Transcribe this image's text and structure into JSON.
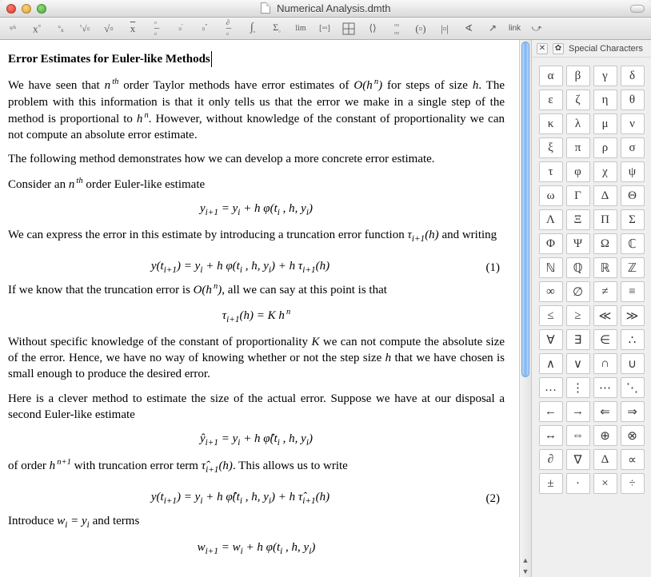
{
  "window": {
    "title": "Numerical Analysis.dmth"
  },
  "toolbar": {
    "link_label": "link"
  },
  "palette": {
    "title": "Special Characters",
    "symbols": [
      "α",
      "β",
      "γ",
      "δ",
      "ε",
      "ζ",
      "η",
      "θ",
      "κ",
      "λ",
      "μ",
      "ν",
      "ξ",
      "π",
      "ρ",
      "σ",
      "τ",
      "φ",
      "χ",
      "ψ",
      "ω",
      "Γ",
      "Δ",
      "Θ",
      "Λ",
      "Ξ",
      "Π",
      "Σ",
      "Φ",
      "Ψ",
      "Ω",
      "ℂ",
      "ℕ",
      "ℚ",
      "ℝ",
      "ℤ",
      "∞",
      "∅",
      "≠",
      "≡",
      "≤",
      "≥",
      "≪",
      "≫",
      "∀",
      "∃",
      "∈",
      "∴",
      "∧",
      "∨",
      "∩",
      "∪",
      "…",
      "⋮",
      "⋯",
      "⋱",
      "←",
      "→",
      "⇐",
      "⇒",
      "↔",
      "⇔",
      "⊕",
      "⊗",
      "∂",
      "∇",
      "Δ",
      "∝",
      "±",
      "·",
      "×",
      "÷"
    ]
  },
  "doc": {
    "heading": "Error Estimates for Euler-like Methods",
    "p1a": "We have seen that ",
    "p1b": " order Taylor methods have error estimates of ",
    "p1c": " for steps of size ",
    "p1d": ". The problem with this information is that it only tells us that the error we make in a single step of the method is proportional to ",
    "p1e": ". However, without knowledge of the constant of proportionality we can not compute an absolute error estimate.",
    "p2": "The following method demonstrates how we can develop a more concrete error estimate.",
    "p3a": "Consider an ",
    "p3b": " order Euler-like estimate",
    "eq1": "y<sub>i+1</sub> = y<sub>i</sub> + h φ(t<sub>i</sub> , h, y<sub>i</sub>)",
    "p4a": "We can express the error in this estimate by introducing a truncation error function ",
    "p4b": " and writing",
    "eq2": "y(t<sub>i+1</sub>) = y<sub>i</sub> + h φ(t<sub>i</sub> , h, y<sub>i</sub>) + h τ<sub>i+1</sub>(h)",
    "eq2num": "(1)",
    "p5a": "If we know that the truncation error is ",
    "p5b": ", all we can say at this point is that",
    "eq3": "τ<sub>i+1</sub>(h) = K h<sup>&thinsp;n</sup>",
    "p6a": "Without specific knowledge of the constant of proportionality ",
    "p6b": " we can not compute the absolute size of the error. Hence, we have no way of knowing whether or not the step size ",
    "p6c": " that we have chosen is small enough to produce the desired error.",
    "p7": "Here is a clever method to estimate the size of the actual error. Suppose we have at our disposal a second Euler-like estimate",
    "eq4": "ŷ<sub>i+1</sub> = y<sub>i</sub> + h φ̂(t<sub>i</sub> , h, y<sub>i</sub>)",
    "p8a": "of order ",
    "p8b": " with truncation error term ",
    "p8c": ". This allows us to write",
    "eq5": "y(t<sub>i+1</sub>) = y<sub>i</sub> + h φ̂(t<sub>i</sub> , h, y<sub>i</sub>) + h τ̂<sub>i+1</sub>(h)",
    "eq5num": "(2)",
    "p9a": "Introduce ",
    "p9b": " and terms",
    "eq6": "w<sub>i+1</sub> = w<sub>i</sub> + h φ(t<sub>i</sub> , h, y<sub>i</sub>)"
  }
}
